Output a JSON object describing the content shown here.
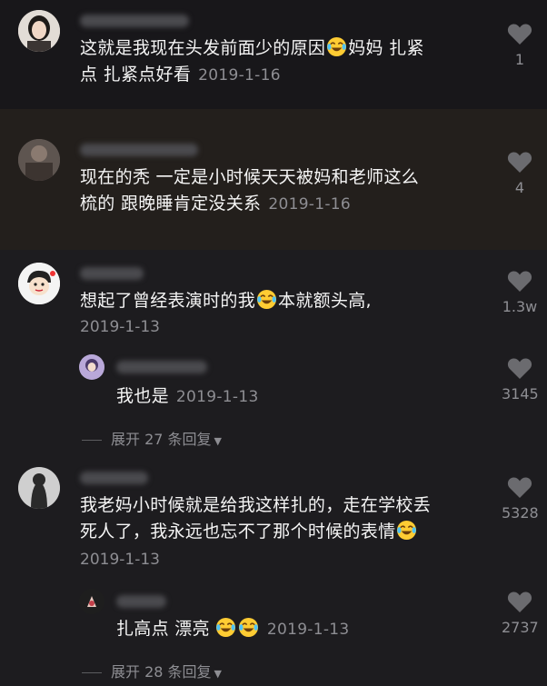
{
  "comments": [
    {
      "text_line1": "这就是我现在头发前面少的原因",
      "text_line1b": "妈妈 扎紧",
      "text_line2": "点 扎紧点好看",
      "date": "2019-1-16",
      "likes": "1"
    },
    {
      "text_line1": "现在的秃 一定是小时候天天被妈和老师这么",
      "text_line2": "梳的 跟晚睡肯定没关系",
      "date": "2019-1-16",
      "likes": "4"
    },
    {
      "text_line1a": "想起了曾经表演时的我",
      "text_line1b": "本就额头高,",
      "date": "2019-1-13",
      "likes": "1.3w",
      "reply": {
        "text": "我也是",
        "date": "2019-1-13",
        "likes": "3145"
      },
      "expand_label": "展开 27 条回复"
    },
    {
      "text_line1": "我老妈小时候就是给我这样扎的，走在学校丢",
      "text_line2": "死人了，我永远也忘不了那个时候的表情",
      "date": "2019-1-13",
      "likes": "5328",
      "reply": {
        "text": "扎高点 漂亮",
        "date": "2019-1-13",
        "likes": "2737"
      },
      "expand_label": "展开 28 条回复"
    }
  ],
  "colors": {
    "background": "#1b1a1d",
    "text": "#f5f5f5",
    "muted": "#8e8e93",
    "heart": "#6b6b6f"
  },
  "icons": {
    "like": "heart-icon",
    "emoji": "laugh-cry-emoji-icon",
    "expand": "caret-down-icon"
  }
}
